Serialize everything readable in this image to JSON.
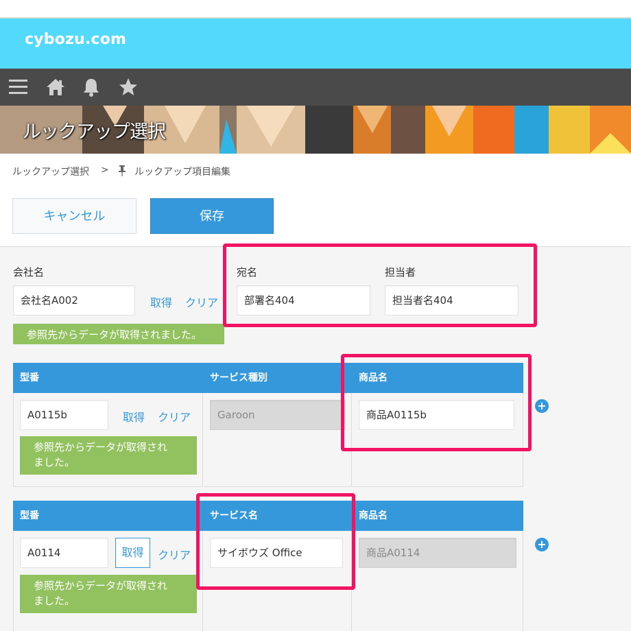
{
  "app": {
    "brand": "cybozu.com"
  },
  "nav": {
    "icons": [
      "menu-icon",
      "home-icon",
      "bell-icon",
      "star-icon"
    ]
  },
  "banner": {
    "title": "ルックアップ選択"
  },
  "breadcrumb": {
    "app": "ルックアップ選択",
    "separator": ">",
    "page": "ルックアップ項目編集"
  },
  "actions": {
    "cancel": "キャンセル",
    "save": "保存"
  },
  "header_fields": {
    "company": {
      "label": "会社名",
      "value": "会社名A002",
      "fetch": "取得",
      "clear": "クリア",
      "notice": "参照先からデータが取得されました。"
    },
    "addressee": {
      "label": "宛名",
      "value": "部署名404"
    },
    "person": {
      "label": "担当者",
      "value": "担当者名404"
    }
  },
  "table1": {
    "columns": [
      "型番",
      "サービス種別",
      "商品名"
    ],
    "row": {
      "model": "A0115b",
      "fetch": "取得",
      "clear": "クリア",
      "notice_line1": "参照先からデータが取得され",
      "notice_line2": "ました。",
      "service": "Garoon",
      "product": "商品A0115b"
    },
    "add": "+"
  },
  "table2": {
    "columns": [
      "型番",
      "サービス名",
      "商品名"
    ],
    "row": {
      "model": "A0114",
      "fetch": "取得",
      "clear": "クリア",
      "notice_line1": "参照先からデータが取得され",
      "notice_line2": "ました。",
      "service": "サイボウズ Office",
      "product": "商品A0114"
    },
    "add": "+"
  },
  "colors": {
    "brand_bar": "#52d9fc",
    "nav_bar": "#4a4a4a",
    "accent": "#3498db",
    "success": "#92c260",
    "highlight": "#f01463"
  }
}
